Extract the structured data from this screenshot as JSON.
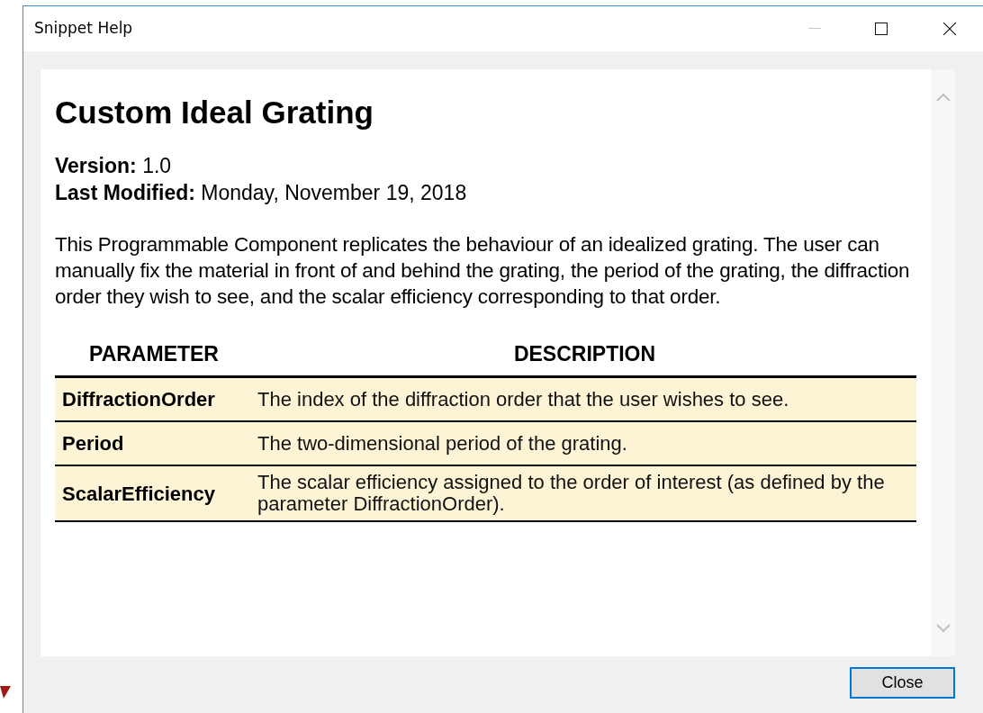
{
  "window": {
    "title": "Snippet Help"
  },
  "doc": {
    "title": "Custom Ideal Grating",
    "meta": [
      {
        "label": "Version:",
        "value": "1.0"
      },
      {
        "label": "Last Modified:",
        "value": "Monday, November 19, 2018"
      }
    ],
    "description": "This Programmable Component replicates the behaviour of an idealized grating. The user can manually fix the material in front of and behind the grating, the period of the grating, the diffraction order they wish to see, and the scalar efficiency corresponding to that order.",
    "table": {
      "columns": [
        "PARAMETER",
        "DESCRIPTION"
      ],
      "rows": [
        [
          "DiffractionOrder",
          "The index of the diffraction order that the user wishes to see."
        ],
        [
          "Period",
          "The two-dimensional period of the grating."
        ],
        [
          "ScalarEfficiency",
          "The scalar efficiency assigned to the order of interest (as defined by the parameter DiffractionOrder)."
        ]
      ]
    }
  },
  "buttons": [
    "Close"
  ]
}
